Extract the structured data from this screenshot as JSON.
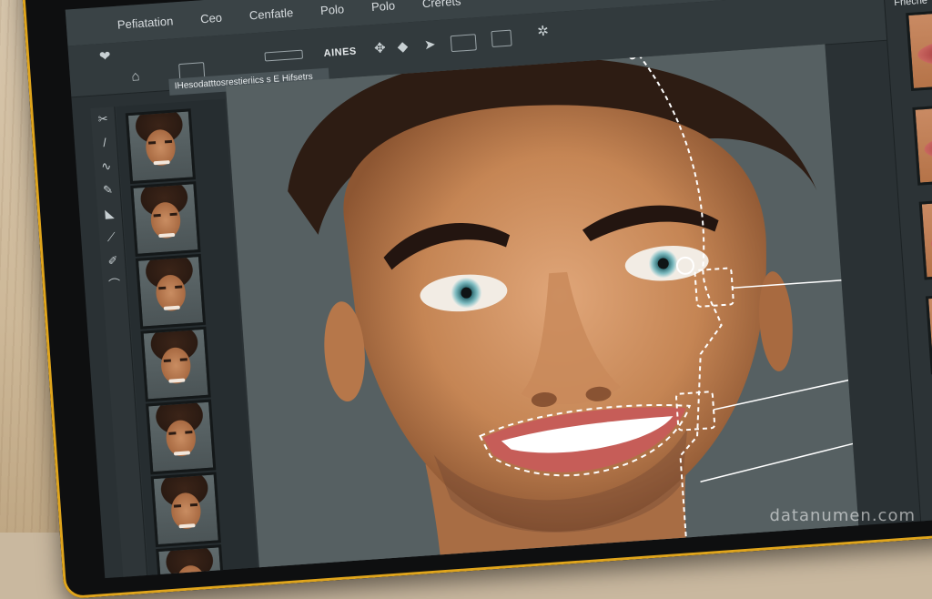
{
  "menu": [
    "Pefiatation",
    "Ceo",
    "Cenfatle",
    "Polo",
    "Polo",
    "Crerets"
  ],
  "toolbar": {
    "label": "AINES",
    "breadcrumb": "IHesodatttosrestieriics  s E Hifsetrs"
  },
  "tools_icons": [
    "crop-icon",
    "brush-icon",
    "lasso-icon",
    "pen-icon",
    "selection-icon",
    "brush-icon",
    "paint-icon",
    "pen-icon"
  ],
  "thumbnails_count": 7,
  "right_panel": {
    "title": "Frieche",
    "lock_icon": "lock-icon",
    "items_count": 5
  },
  "watermark": "datanumen.com",
  "colors": {
    "bezel": "#0e0f10",
    "bezel_accent": "#e0a51c",
    "panel": "#2c3336",
    "selection": "#ffffff"
  }
}
